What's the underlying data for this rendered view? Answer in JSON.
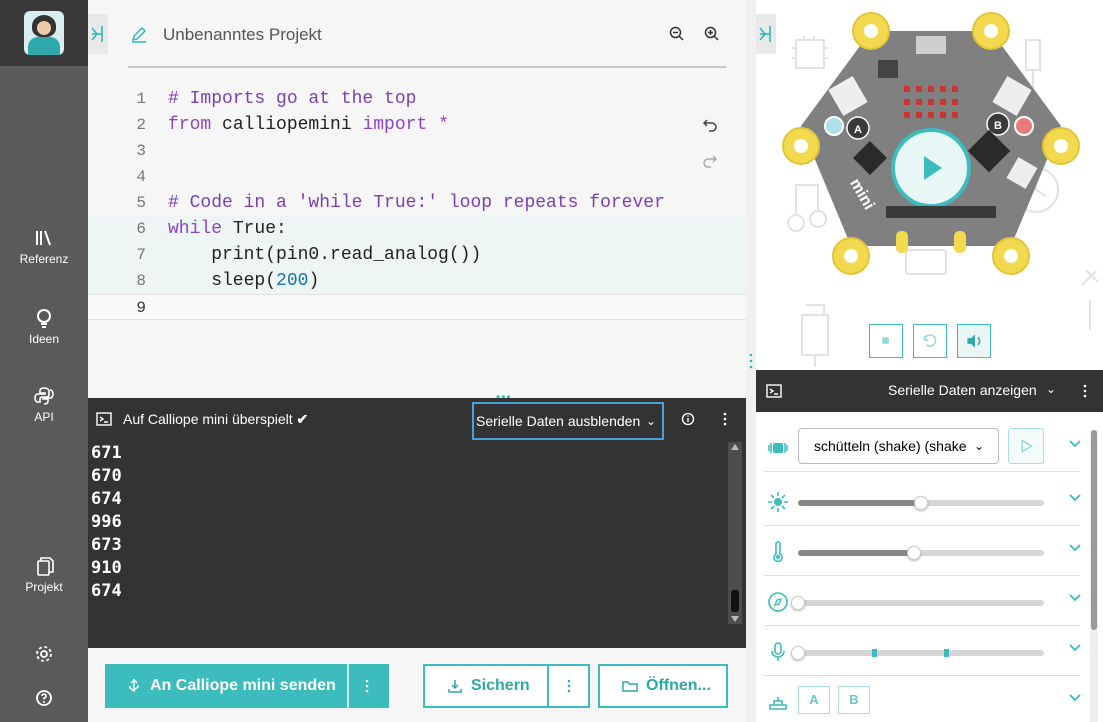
{
  "nav": {
    "items": [
      {
        "label": "Referenz",
        "icon": "library-icon"
      },
      {
        "label": "Ideen",
        "icon": "lightbulb-icon"
      },
      {
        "label": "API",
        "icon": "python-icon"
      },
      {
        "label": "Projekt",
        "icon": "files-icon"
      }
    ]
  },
  "editor": {
    "project_title": "Unbenanntes Projekt",
    "lines": [
      {
        "n": "1",
        "parts": [
          {
            "t": "# Imports go at the top",
            "c": "cm"
          }
        ]
      },
      {
        "n": "2",
        "parts": [
          {
            "t": "from ",
            "c": "kw"
          },
          {
            "t": "calliopemini ",
            "c": "nm"
          },
          {
            "t": "import ",
            "c": "kw"
          },
          {
            "t": "*",
            "c": "kw"
          }
        ]
      },
      {
        "n": "3",
        "parts": []
      },
      {
        "n": "4",
        "parts": []
      },
      {
        "n": "5",
        "parts": [
          {
            "t": "# Code in a 'while True:' loop repeats forever",
            "c": "cm"
          }
        ]
      },
      {
        "n": "6",
        "parts": [
          {
            "t": "while ",
            "c": "kw"
          },
          {
            "t": "True:",
            "c": "nm"
          }
        ]
      },
      {
        "n": "7",
        "parts": [
          {
            "t": "    print(pin0.read_analog())",
            "c": "nm"
          }
        ]
      },
      {
        "n": "8",
        "parts": [
          {
            "t": "    sleep(",
            "c": "nm"
          },
          {
            "t": "200",
            "c": "numlit"
          },
          {
            "t": ")",
            "c": "nm"
          }
        ]
      },
      {
        "n": "9",
        "parts": []
      }
    ]
  },
  "console": {
    "status": "Auf Calliope mini überspielt",
    "toggle_label": "Serielle Daten ausblenden",
    "output": [
      "671",
      "670",
      "674",
      "996",
      "673",
      "910",
      "674"
    ]
  },
  "actions": {
    "send_label": "An Calliope mini senden",
    "save_label": "Sichern",
    "open_label": "Öffnen..."
  },
  "serial_panel": {
    "label": "Serielle Daten anzeigen"
  },
  "sensors": {
    "gesture_value": "schütteln (shake) (shake",
    "light_level": 0.5,
    "temperature_level": 0.47,
    "compass_level": 0.0,
    "sound_level": 0.0,
    "button_a": "A",
    "button_b": "B"
  },
  "colors": {
    "accent": "#3cbcbc",
    "nav_bg": "#5a5a5a",
    "console_bg": "#333333"
  }
}
